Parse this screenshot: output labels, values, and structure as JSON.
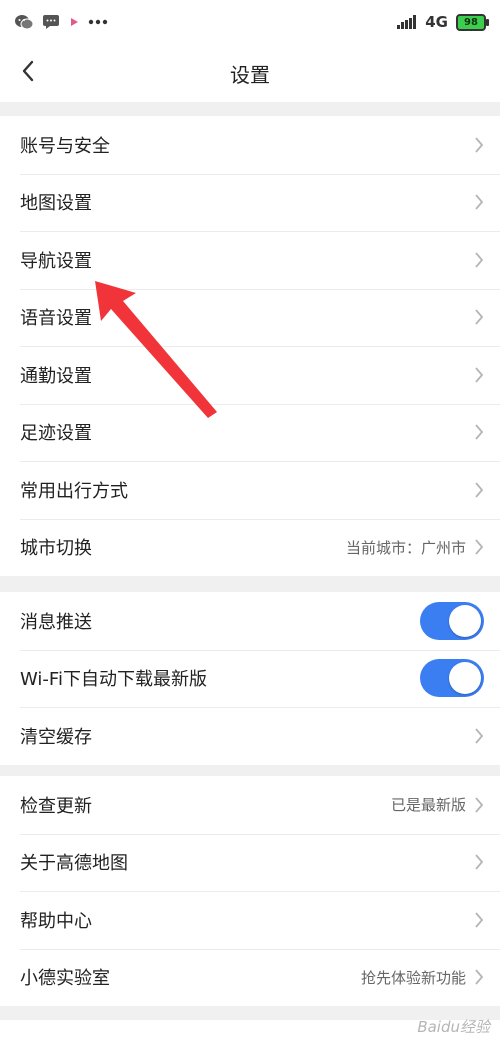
{
  "status_bar": {
    "network_label": "4G",
    "battery_level": "98",
    "icons": [
      "wechat-icon",
      "message-icon",
      "play-icon",
      "more-dots-icon",
      "signal-icon",
      "battery-icon"
    ]
  },
  "header": {
    "title": "设置",
    "back_icon": "chevron-left-icon"
  },
  "group1": {
    "items": [
      {
        "label": "账号与安全"
      },
      {
        "label": "地图设置"
      },
      {
        "label": "导航设置"
      },
      {
        "label": "语音设置"
      },
      {
        "label": "通勤设置"
      },
      {
        "label": "足迹设置"
      },
      {
        "label": "常用出行方式"
      },
      {
        "label": "城市切换",
        "value": "当前城市：广州市"
      }
    ]
  },
  "group2": {
    "items": [
      {
        "label": "消息推送",
        "toggle_on": true
      },
      {
        "label": "Wi-Fi下自动下载最新版",
        "toggle_on": true
      },
      {
        "label": "清空缓存"
      }
    ]
  },
  "group3": {
    "items": [
      {
        "label": "检查更新",
        "value": "已是最新版"
      },
      {
        "label": "关于高德地图"
      },
      {
        "label": "帮助中心"
      },
      {
        "label": "小德实验室",
        "value": "抢先体验新功能"
      }
    ]
  },
  "watermark": "Baidu经验",
  "colors": {
    "toggle_on": "#3b7ef2",
    "annotation_arrow": "#f0343a",
    "battery": "#3ccf4e"
  }
}
